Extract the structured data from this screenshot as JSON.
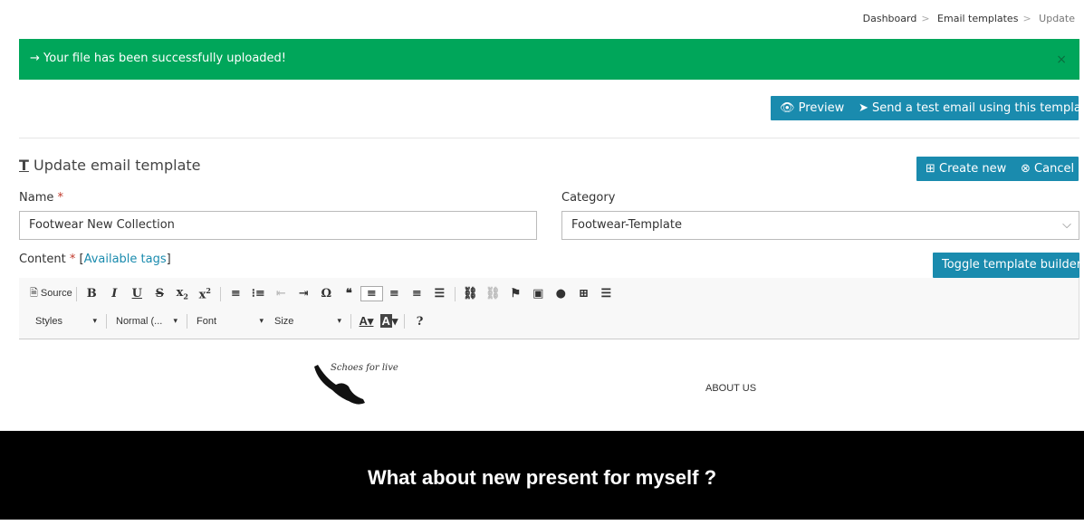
{
  "breadcrumb": [
    "Dashboard",
    "Email templates",
    "Update"
  ],
  "alert": {
    "message": "→ Your file has been successfully uploaded!",
    "close": "×"
  },
  "actions": {
    "preview": "Preview",
    "send_test": "Send a test email using this template"
  },
  "form": {
    "heading": "Update email template",
    "create_new": "Create new",
    "cancel": "Cancel",
    "name_label": "Name",
    "required": "*",
    "name_value": "Footwear New Collection",
    "category_label": "Category",
    "category_value": "Footwear-Template",
    "content_label": "Content",
    "available_tags": "Available tags",
    "toggle_builder": "Toggle template builder"
  },
  "toolbar": {
    "source": "Source",
    "styles": "Styles",
    "format": "Normal (...",
    "font": "Font",
    "size": "Size",
    "help": "?"
  },
  "content": {
    "logo_text": "Schoes for live",
    "about": "ABOUT US",
    "banner": "What about new present for myself ?"
  },
  "colors": {
    "success": "#00a65a",
    "primary": "#1a8bae"
  }
}
